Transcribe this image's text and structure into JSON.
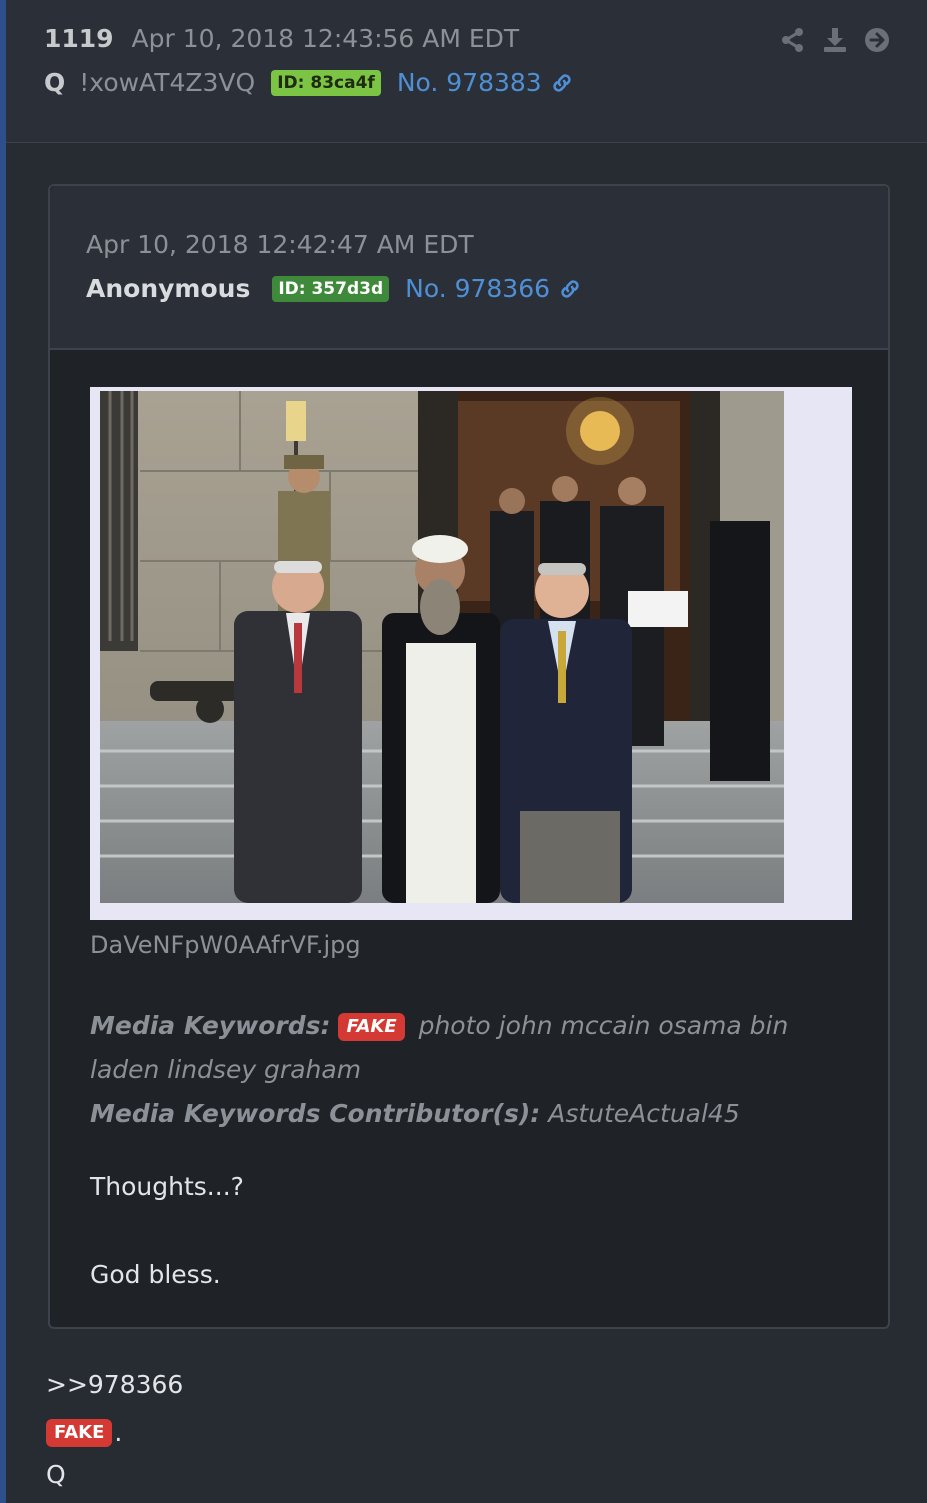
{
  "post": {
    "number": "1119",
    "date": "Apr 10, 2018 12:43:56 AM EDT",
    "author": "Q",
    "tripcode": "!xowAT4Z3VQ",
    "id_badge": "ID: 83ca4f",
    "post_no": "No. 978383",
    "actions": [
      "share-icon",
      "download-icon",
      "arrow-right-circle-icon"
    ]
  },
  "quoted": {
    "date": "Apr 10, 2018 12:42:47 AM EDT",
    "author": "Anonymous",
    "id_badge": "ID: 357d3d",
    "post_no": "No. 978366",
    "image_filename": "DaVeNFpW0AAfrVF.jpg",
    "keywords_label": "Media Keywords:",
    "keywords_badge": "FAKE",
    "keywords_text": "photo john mccain osama bin laden lindsey graham",
    "contributors_label": "Media Keywords Contributor(s):",
    "contributors_text": "AstuteActual45",
    "body_line1": "Thoughts...?",
    "body_line2": "God bless."
  },
  "reply": {
    "ref": ">>978366",
    "badge": "FAKE",
    "suffix": ".",
    "signature": "Q"
  },
  "colors": {
    "background": "#272c33",
    "link": "#4f8fd6",
    "id_q": "#7cc443",
    "id_anon": "#3f8a3a",
    "fake": "#d43a33"
  }
}
